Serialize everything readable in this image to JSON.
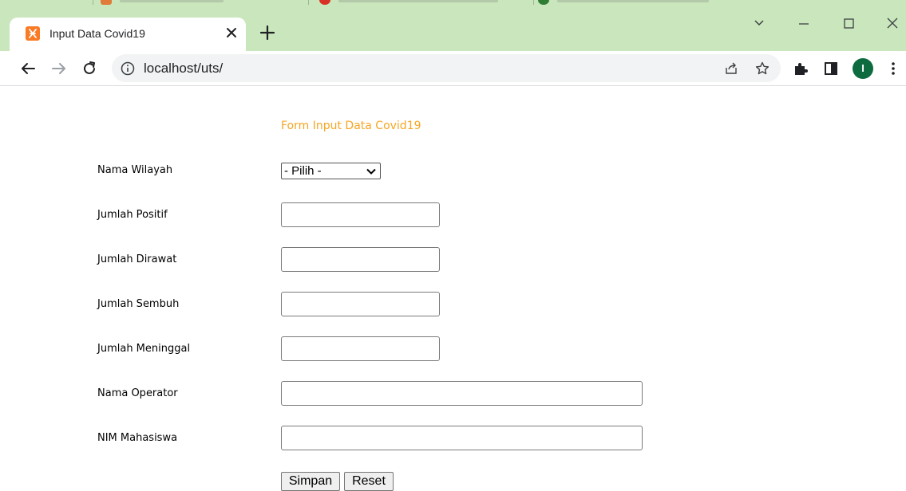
{
  "browser": {
    "tab": {
      "title": "Input Data Covid19",
      "favicon": "xampp-icon"
    },
    "url": "localhost/uts/",
    "profile_initial": "I",
    "accent": "#c9e6bc"
  },
  "form": {
    "title": "Form Input Data Covid19",
    "title_color": "#f5a623",
    "labels": {
      "wilayah": "Nama Wilayah",
      "positif": "Jumlah Positif",
      "dirawat": "Jumlah Dirawat",
      "sembuh": "Jumlah Sembuh",
      "meninggal": "Jumlah Meninggal",
      "operator": "Nama Operator",
      "nim": "NIM Mahasiswa"
    },
    "wilayah_selected": "- Pilih -",
    "values": {
      "positif": "",
      "dirawat": "",
      "sembuh": "",
      "meninggal": "",
      "operator": "",
      "nim": ""
    },
    "buttons": {
      "save": "Simpan",
      "reset": "Reset"
    }
  }
}
